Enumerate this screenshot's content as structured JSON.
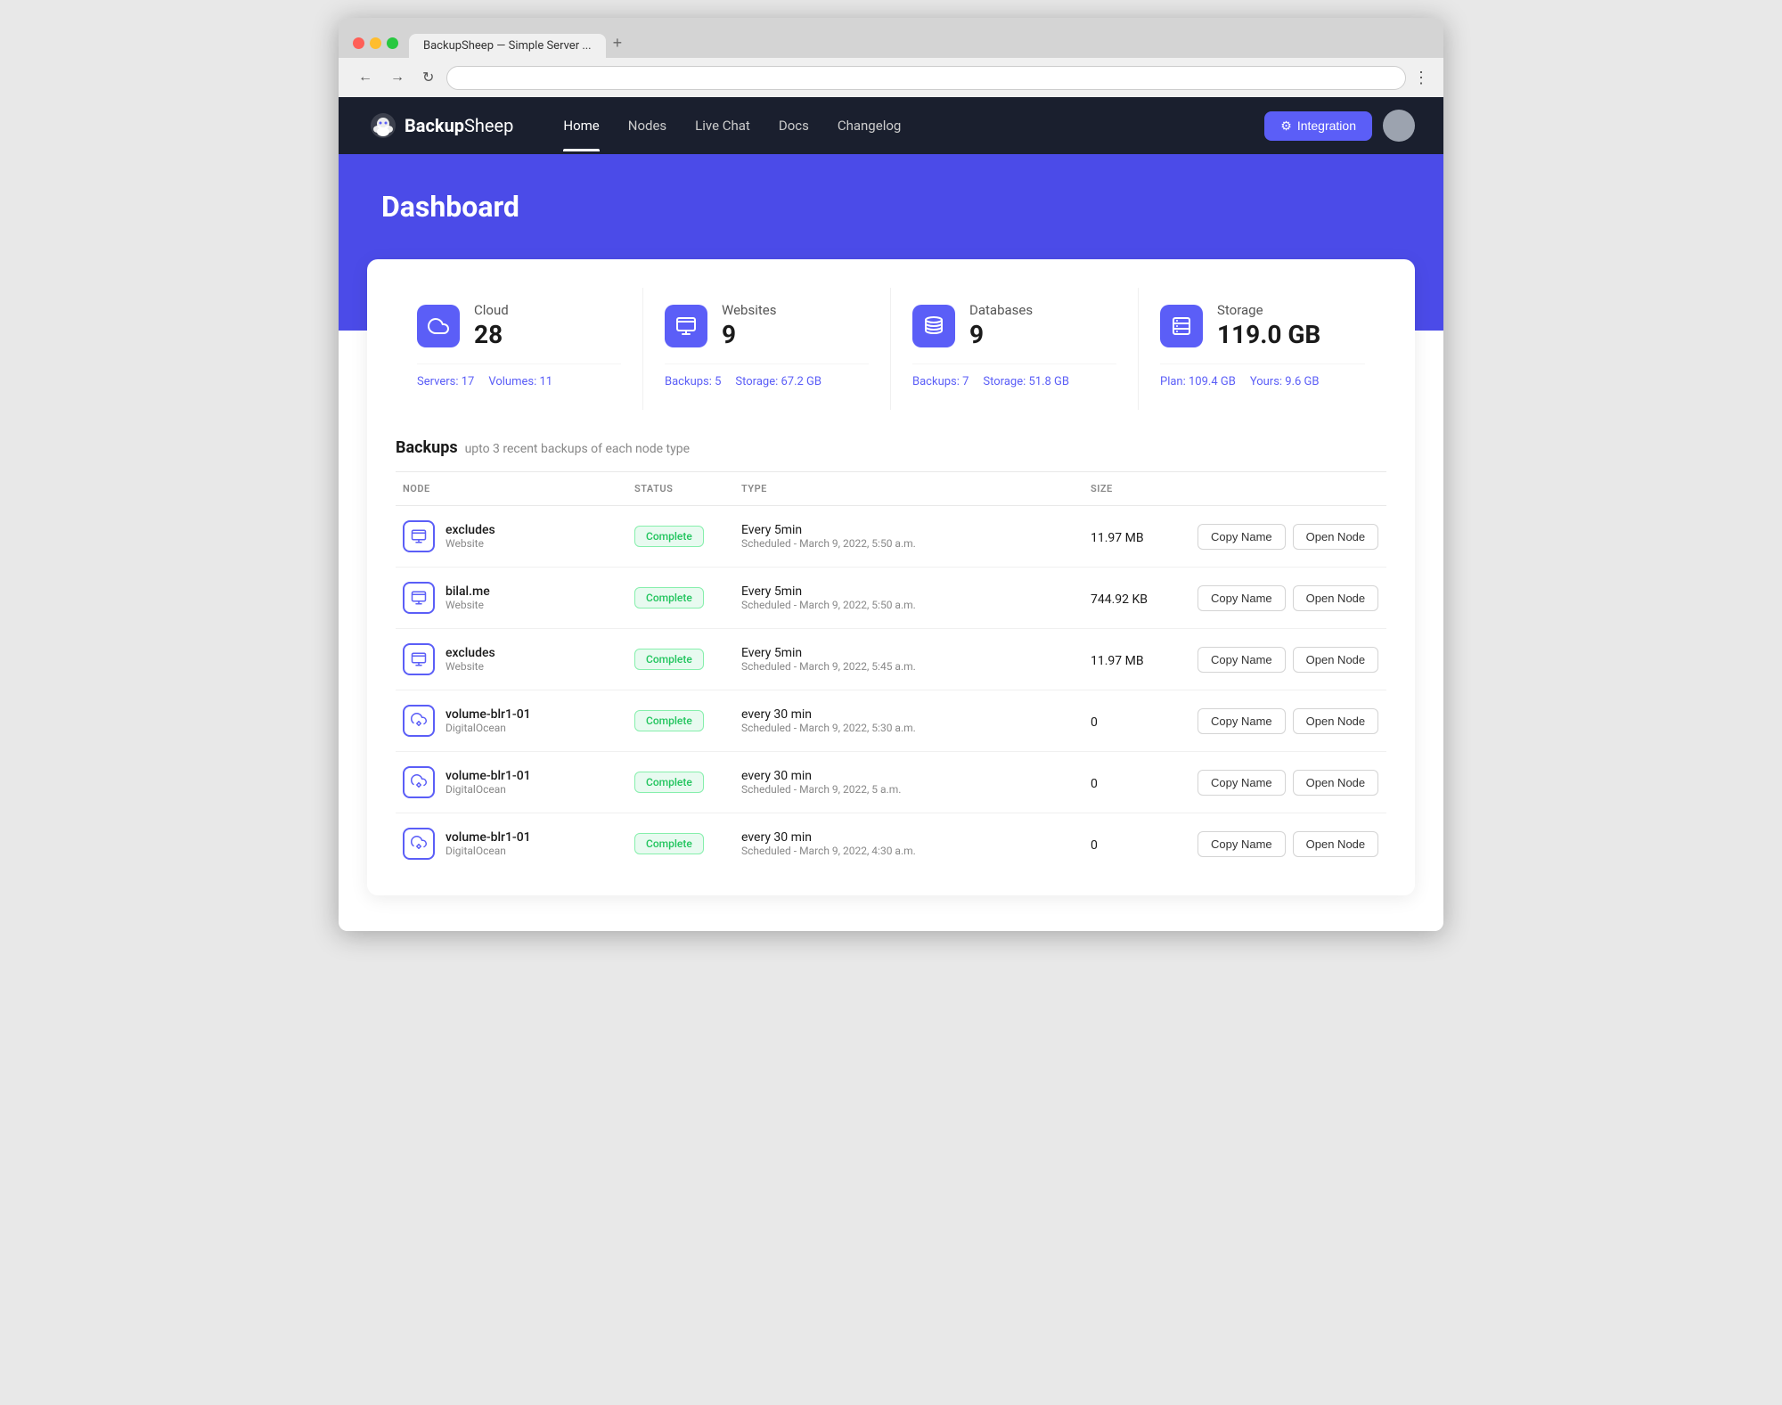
{
  "browser": {
    "tab_label": "BackupSheep — Simple Server ...",
    "tab_plus": "+",
    "nav_back": "←",
    "nav_forward": "→",
    "nav_reload": "↻",
    "address": "",
    "menu_dots": "⋮"
  },
  "navbar": {
    "brand": "BackupSheep",
    "brand_prefix": "Backup",
    "brand_suffix": "Sheep",
    "nav_items": [
      {
        "label": "Home",
        "active": true
      },
      {
        "label": "Nodes",
        "active": false
      },
      {
        "label": "Live Chat",
        "active": false
      },
      {
        "label": "Docs",
        "active": false
      },
      {
        "label": "Changelog",
        "active": false
      }
    ],
    "integration_btn": "Integration"
  },
  "hero": {
    "title": "Dashboard"
  },
  "stats": [
    {
      "icon_name": "cloud-icon",
      "label": "Cloud",
      "value": "28",
      "links": [
        {
          "label": "Servers: 17"
        },
        {
          "label": "Volumes: 11"
        }
      ]
    },
    {
      "icon_name": "website-icon",
      "label": "Websites",
      "value": "9",
      "links": [
        {
          "label": "Backups: 5"
        },
        {
          "label": "Storage: 67.2 GB"
        }
      ]
    },
    {
      "icon_name": "database-icon",
      "label": "Databases",
      "value": "9",
      "links": [
        {
          "label": "Backups: 7"
        },
        {
          "label": "Storage: 51.8 GB"
        }
      ]
    },
    {
      "icon_name": "storage-icon",
      "label": "Storage",
      "value": "119.0 GB",
      "links": [
        {
          "label": "Plan: 109.4 GB"
        },
        {
          "label": "Yours: 9.6 GB"
        }
      ]
    }
  ],
  "backups": {
    "title": "Backups",
    "subtitle": "upto 3 recent backups of each node type",
    "columns": [
      "NODE",
      "STATUS",
      "TYPE",
      "SIZE",
      ""
    ],
    "rows": [
      {
        "icon_name": "website-node-icon",
        "name": "excludes",
        "type": "Website",
        "status": "Complete",
        "type_primary": "Every 5min",
        "type_secondary": "Scheduled - March 9, 2022, 5:50 a.m.",
        "size": "11.97 MB",
        "btn1": "Copy Name",
        "btn2": "Open Node"
      },
      {
        "icon_name": "website-node-icon",
        "name": "bilal.me",
        "type": "Website",
        "status": "Complete",
        "type_primary": "Every 5min",
        "type_secondary": "Scheduled - March 9, 2022, 5:50 a.m.",
        "size": "744.92 KB",
        "btn1": "Copy Name",
        "btn2": "Open Node"
      },
      {
        "icon_name": "website-node-icon",
        "name": "excludes",
        "type": "Website",
        "status": "Complete",
        "type_primary": "Every 5min",
        "type_secondary": "Scheduled - March 9, 2022, 5:45 a.m.",
        "size": "11.97 MB",
        "btn1": "Copy Name",
        "btn2": "Open Node"
      },
      {
        "icon_name": "cloud-node-icon",
        "name": "volume-blr1-01",
        "type": "DigitalOcean",
        "status": "Complete",
        "type_primary": "every 30 min",
        "type_secondary": "Scheduled - March 9, 2022, 5:30 a.m.",
        "size": "0",
        "btn1": "Copy Name",
        "btn2": "Open Node"
      },
      {
        "icon_name": "cloud-node-icon",
        "name": "volume-blr1-01",
        "type": "DigitalOcean",
        "status": "Complete",
        "type_primary": "every 30 min",
        "type_secondary": "Scheduled - March 9, 2022, 5 a.m.",
        "size": "0",
        "btn1": "Copy Name",
        "btn2": "Open Node"
      },
      {
        "icon_name": "cloud-node-icon",
        "name": "volume-blr1-01",
        "type": "DigitalOcean",
        "status": "Complete",
        "type_primary": "every 30 min",
        "type_secondary": "Scheduled - March 9, 2022, 4:30 a.m.",
        "size": "0",
        "btn1": "Copy Name",
        "btn2": "Open Node"
      }
    ]
  },
  "colors": {
    "accent": "#5b5ef7",
    "complete_bg": "#e8faf0",
    "complete_text": "#22c55e"
  }
}
